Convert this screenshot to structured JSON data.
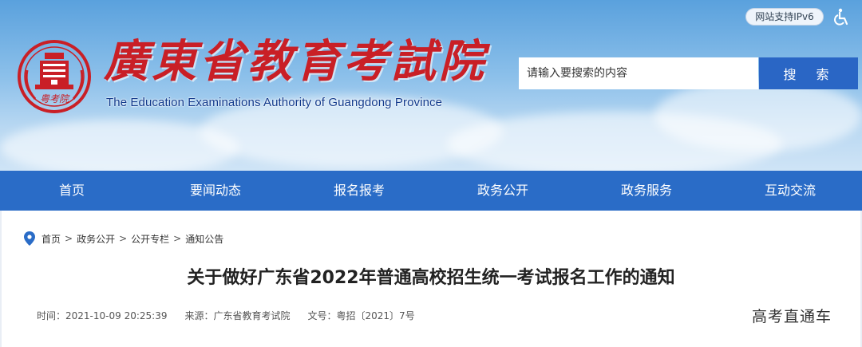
{
  "header": {
    "ipv6_badge": "网站支持IPv6",
    "site_title": "廣東省教育考試院",
    "site_subtitle": "The Education Examinations Authority of Guangdong Province",
    "logo_text": "粤考院",
    "search": {
      "placeholder": "请输入要搜索的内容",
      "button_label": "搜 索"
    }
  },
  "nav": {
    "items": [
      {
        "label": "首页"
      },
      {
        "label": "要闻动态"
      },
      {
        "label": "报名报考"
      },
      {
        "label": "政务公开"
      },
      {
        "label": "政务服务"
      },
      {
        "label": "互动交流"
      }
    ]
  },
  "breadcrumb": {
    "items": [
      "首页",
      "政务公开",
      "公开专栏",
      "通知公告"
    ],
    "separator": ">"
  },
  "article": {
    "title": "关于做好广东省2022年普通高校招生统一考试报名工作的通知",
    "time_label": "时间：",
    "time": "2021-10-09 20:25:39",
    "source_label": "来源：",
    "source": "广东省教育考试院",
    "doc_no_label": "文号：",
    "doc_no": "粤招〔2021〕7号"
  },
  "watermark": "高考直通车",
  "colors": {
    "nav_bg": "#2a6cc7",
    "search_button": "#2a66c5",
    "title_red": "#c91f26",
    "subtitle_blue": "#123a8c"
  }
}
